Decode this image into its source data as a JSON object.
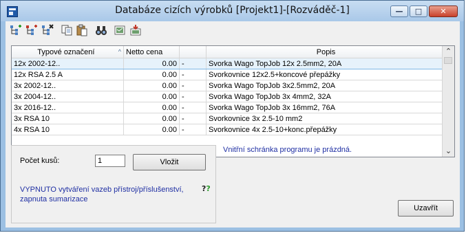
{
  "window": {
    "title": "Databáze cizích výrobků [Projekt1]-[Rozváděč-1]",
    "controls": [
      "minimize",
      "maximize",
      "close"
    ]
  },
  "toolbar": {
    "buttons": [
      {
        "icon": "tree-add-icon"
      },
      {
        "icon": "tree-insert-icon"
      },
      {
        "icon": "tree-delete-icon"
      },
      {
        "icon": "copy-icon"
      },
      {
        "icon": "paste-icon"
      },
      {
        "icon": "binoculars-search-icon"
      },
      {
        "icon": "export-icon"
      },
      {
        "icon": "import-icon"
      }
    ]
  },
  "table": {
    "columns": [
      "Typové označení",
      "Netto cena",
      "",
      "Popis"
    ],
    "sort_indicator": "^",
    "rows": [
      {
        "type": "12x 2002-12..",
        "price": "0.00",
        "sep": "-",
        "desc": "Svorka Wago TopJob 12x 2.5mm2, 20A",
        "selected": true
      },
      {
        "type": "12x RSA 2.5 A",
        "price": "0.00",
        "sep": "-",
        "desc": "Svorkovnice 12x2.5+koncové přepážky"
      },
      {
        "type": "3x 2002-12..",
        "price": "0.00",
        "sep": "-",
        "desc": "Svorka Wago TopJob 3x2.5mm2, 20A"
      },
      {
        "type": "3x 2004-12..",
        "price": "0.00",
        "sep": "-",
        "desc": "Svorka Wago TopJob 3x 4mm2, 32A"
      },
      {
        "type": "3x 2016-12..",
        "price": "0.00",
        "sep": "-",
        "desc": "Svorka Wago TopJob 3x 16mm2, 76A"
      },
      {
        "type": "3x RSA 10",
        "price": "0.00",
        "sep": "-",
        "desc": "Svorkovnice 3x 2.5-10 mm2"
      },
      {
        "type": "4x RSA 10",
        "price": "0.00",
        "sep": "-",
        "desc": "Svorkovnice 4x 2.5-10+konc.přepážky"
      }
    ]
  },
  "form": {
    "qty_label": "Počet kusů:",
    "qty_value": "1",
    "insert_label": "Vložit",
    "status_text": "VYPNUTO vytváření vazeb přístroj/příslušenství, zapnuta sumarizace",
    "help_icon": "help-question-icon",
    "clipboard_msg": "Vnitřní schránka programu je prázdná.",
    "close_label": "Uzavřít"
  }
}
